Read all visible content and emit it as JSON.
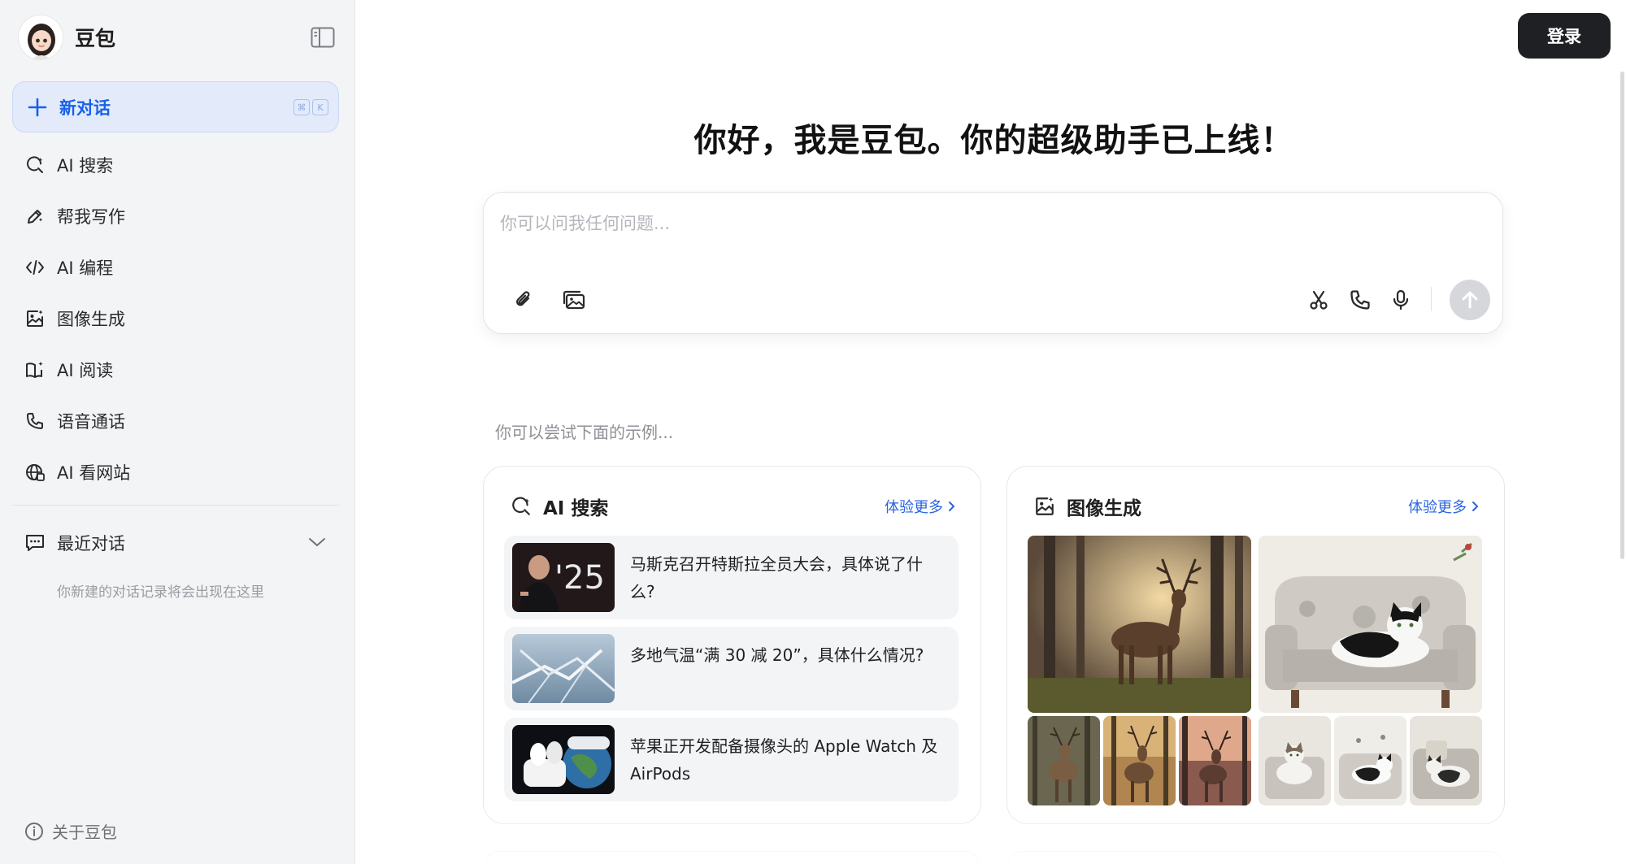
{
  "brand": {
    "name": "豆包"
  },
  "sidebar": {
    "new_chat": {
      "label": "新对话",
      "shortcut": [
        "⌘",
        "K"
      ]
    },
    "items": [
      {
        "label": "AI 搜索",
        "icon": "ai-search-icon"
      },
      {
        "label": "帮我写作",
        "icon": "writing-pen-icon"
      },
      {
        "label": "AI 编程",
        "icon": "code-icon"
      },
      {
        "label": "图像生成",
        "icon": "image-gen-icon"
      },
      {
        "label": "AI 阅读",
        "icon": "reading-book-icon"
      },
      {
        "label": "语音通话",
        "icon": "phone-icon"
      },
      {
        "label": "AI 看网站",
        "icon": "globe-icon"
      }
    ],
    "recent": {
      "label": "最近对话",
      "empty_text": "你新建的对话记录将会出现在这里"
    },
    "about": {
      "label": "关于豆包"
    }
  },
  "header": {
    "login_label": "登录"
  },
  "main": {
    "headline": "你好，我是豆包。你的超级助手已上线！",
    "composer": {
      "placeholder": "你可以问我任何问题..."
    },
    "examples_hint": "你可以尝试下面的示例...",
    "cards": {
      "search": {
        "title": "AI 搜索",
        "more": "体验更多",
        "items": [
          {
            "text": "马斯克召开特斯拉全员大会，具体说了什么?"
          },
          {
            "text": "多地气温“满 30 减 20”，具体什么情况?"
          },
          {
            "text": "苹果正开发配备摄像头的 Apple Watch 及 AirPods"
          }
        ],
        "thumb_overlay_text": "'25"
      },
      "image": {
        "title": "图像生成",
        "more": "体验更多"
      }
    }
  },
  "colors": {
    "accent": "#1861e8",
    "sidebar_bg": "#f3f4f6",
    "new_chat_bg": "#e3ebfb",
    "login_bg": "#1f2023",
    "link": "#2b63e0"
  }
}
